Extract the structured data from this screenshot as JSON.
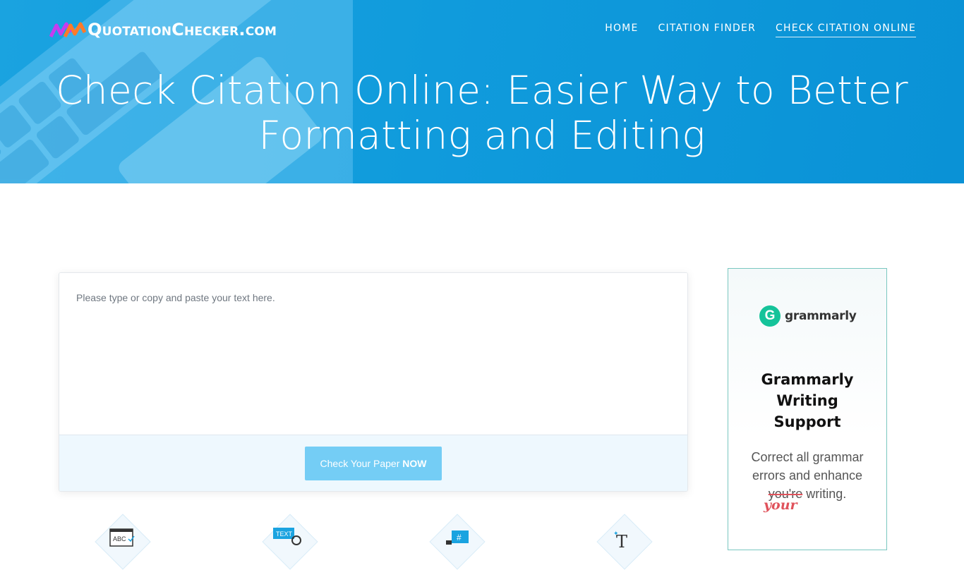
{
  "header": {
    "logo_text": "QuotationChecker.com",
    "nav": [
      {
        "label": "HOME"
      },
      {
        "label": "CITATION FINDER"
      },
      {
        "label": "CHECK CITATION ONLINE",
        "active": true
      }
    ],
    "title": "Check Citation Online: Easier Way to Better Formatting and Editing"
  },
  "editor": {
    "placeholder": "Please type or copy and paste your text here.",
    "button_text": "Check Your Paper ",
    "button_bold": "NOW"
  },
  "features": [
    {
      "icon": "abc-spellcheck-icon",
      "label": "ABC"
    },
    {
      "icon": "text-search-icon",
      "label": "TEXT"
    },
    {
      "icon": "hashtag-icon",
      "label": "#"
    },
    {
      "icon": "typography-icon",
      "label": "T"
    }
  ],
  "ad": {
    "brand": "grammarly",
    "brand_initial": "G",
    "headline_1": "Grammarly",
    "headline_2": "Writing",
    "headline_3": "Support",
    "body_1": "Correct all grammar",
    "body_2": "errors and enhance",
    "body_wrong": "you're",
    "body_end": " writing.",
    "body_fix": "your"
  },
  "colors": {
    "hero": "#109bdc",
    "button": "#74cdf5",
    "grammarly_green": "#15c39a",
    "correction_red": "#e0525b"
  }
}
